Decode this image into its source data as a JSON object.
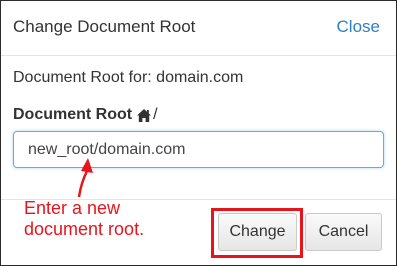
{
  "dialog": {
    "title": "Change Document Root",
    "close_label": "Close"
  },
  "body": {
    "doc_root_for": "Document Root for: domain.com",
    "field_label": "Document Root",
    "field_suffix": "/",
    "input_value": "new_root/domain.com"
  },
  "annotation": {
    "text": "Enter a new\ndocument root.",
    "color": "#e8141b"
  },
  "footer": {
    "change_label": "Change",
    "cancel_label": "Cancel"
  },
  "colors": {
    "accent": "#2f81c4",
    "annotation": "#e8141b"
  },
  "icons": {
    "home": "home-icon",
    "arrow": "arrow-up-icon"
  }
}
